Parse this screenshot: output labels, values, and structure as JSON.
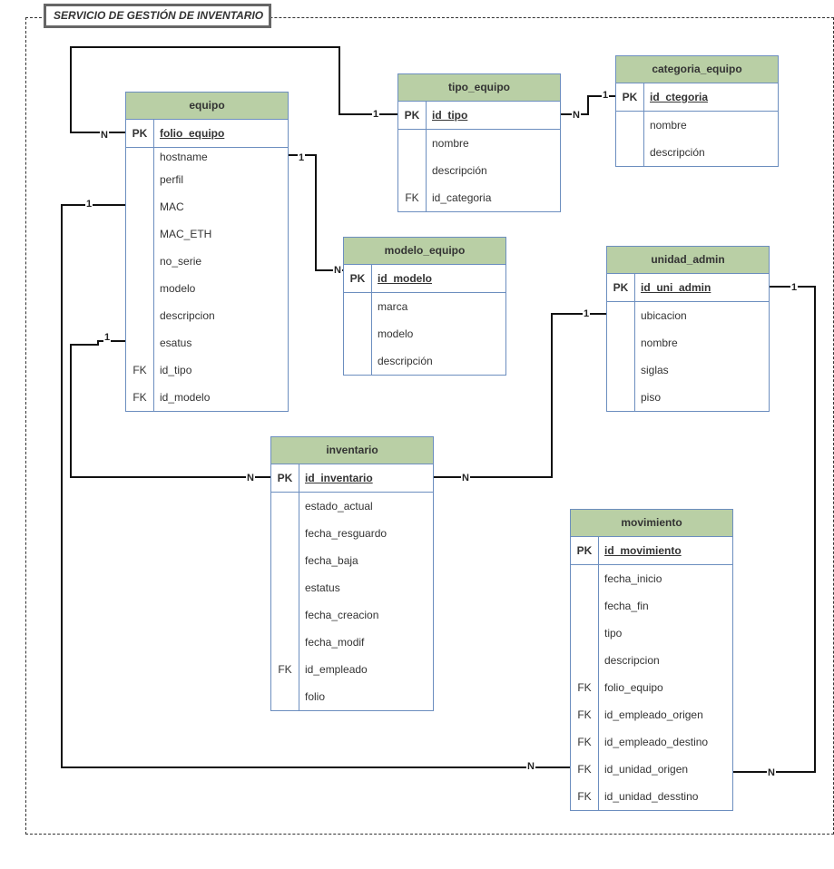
{
  "diagram": {
    "title": "SERVICIO DE GESTIÓN DE INVENTARIO"
  },
  "entities": {
    "equipo": {
      "title": "equipo",
      "pk": {
        "key": "PK",
        "name": "folio_equipo"
      },
      "fields": [
        {
          "key": "",
          "name": "hostname"
        },
        {
          "key": "",
          "name": "perfil"
        },
        {
          "key": "",
          "name": "MAC"
        },
        {
          "key": "",
          "name": "MAC_ETH"
        },
        {
          "key": "",
          "name": "no_serie"
        },
        {
          "key": "",
          "name": "modelo"
        },
        {
          "key": "",
          "name": "descripcion"
        },
        {
          "key": "",
          "name": "esatus"
        },
        {
          "key": "FK",
          "name": "id_tipo"
        },
        {
          "key": "FK",
          "name": "id_modelo"
        }
      ]
    },
    "tipo_equipo": {
      "title": "tipo_equipo",
      "pk": {
        "key": "PK",
        "name": "id_tipo"
      },
      "fields": [
        {
          "key": "",
          "name": "nombre"
        },
        {
          "key": "",
          "name": "descripción"
        },
        {
          "key": "FK",
          "name": "id_categoria"
        }
      ]
    },
    "categoria_equipo": {
      "title": "categoria_equipo",
      "pk": {
        "key": "PK",
        "name": "id_ctegoria"
      },
      "fields": [
        {
          "key": "",
          "name": "nombre"
        },
        {
          "key": "",
          "name": "descripción"
        }
      ]
    },
    "modelo_equipo": {
      "title": "modelo_equipo",
      "pk": {
        "key": "PK",
        "name": "id_modelo"
      },
      "fields": [
        {
          "key": "",
          "name": "marca"
        },
        {
          "key": "",
          "name": "modelo"
        },
        {
          "key": "",
          "name": "descripción"
        }
      ]
    },
    "unidad_admin": {
      "title": "unidad_admin",
      "pk": {
        "key": "PK",
        "name": "id_uni_admin"
      },
      "fields": [
        {
          "key": "",
          "name": "ubicacion"
        },
        {
          "key": "",
          "name": "nombre"
        },
        {
          "key": "",
          "name": "siglas"
        },
        {
          "key": "",
          "name": "piso"
        }
      ]
    },
    "inventario": {
      "title": "inventario",
      "pk": {
        "key": "PK",
        "name": "id_inventario"
      },
      "fields": [
        {
          "key": "",
          "name": "estado_actual"
        },
        {
          "key": "",
          "name": "fecha_resguardo"
        },
        {
          "key": "",
          "name": "fecha_baja"
        },
        {
          "key": "",
          "name": "estatus"
        },
        {
          "key": "",
          "name": "fecha_creacion"
        },
        {
          "key": "",
          "name": "fecha_modif"
        },
        {
          "key": "FK",
          "name": "id_empleado"
        },
        {
          "key": "",
          "name": "folio"
        }
      ]
    },
    "movimiento": {
      "title": "movimiento",
      "pk": {
        "key": "PK",
        "name": "id_movimiento"
      },
      "fields": [
        {
          "key": "",
          "name": "fecha_inicio"
        },
        {
          "key": "",
          "name": "fecha_fin"
        },
        {
          "key": "",
          "name": "tipo"
        },
        {
          "key": "",
          "name": "descripcion"
        },
        {
          "key": "FK",
          "name": "folio_equipo"
        },
        {
          "key": "FK",
          "name": "id_empleado_origen"
        },
        {
          "key": "FK",
          "name": "id_empleado_destino"
        },
        {
          "key": "FK",
          "name": "id_unidad_origen"
        },
        {
          "key": "FK",
          "name": "id_unidad_desstino"
        }
      ]
    }
  },
  "relationships": [
    {
      "name": "equipo-tipo_equipo",
      "from": "tipo_equipo",
      "to": "equipo",
      "one": "1",
      "many": "N"
    },
    {
      "name": "tipo_equipo-categoria_equipo",
      "from": "categoria_equipo",
      "to": "tipo_equipo",
      "one": "1",
      "many": "N"
    },
    {
      "name": "equipo-modelo_equipo",
      "from": "equipo",
      "to": "modelo_equipo",
      "one": "1",
      "many": "N"
    },
    {
      "name": "equipo-inventario",
      "from": "equipo",
      "to": "inventario",
      "one": "1",
      "many": "N"
    },
    {
      "name": "unidad_admin-inventario",
      "from": "unidad_admin",
      "to": "inventario",
      "one": "1",
      "many": "N"
    },
    {
      "name": "equipo-movimiento",
      "from": "equipo",
      "to": "movimiento",
      "one": "1",
      "many": "N"
    },
    {
      "name": "unidad_admin-movimiento",
      "from": "unidad_admin",
      "to": "movimiento",
      "one": "1",
      "many": "N"
    }
  ]
}
